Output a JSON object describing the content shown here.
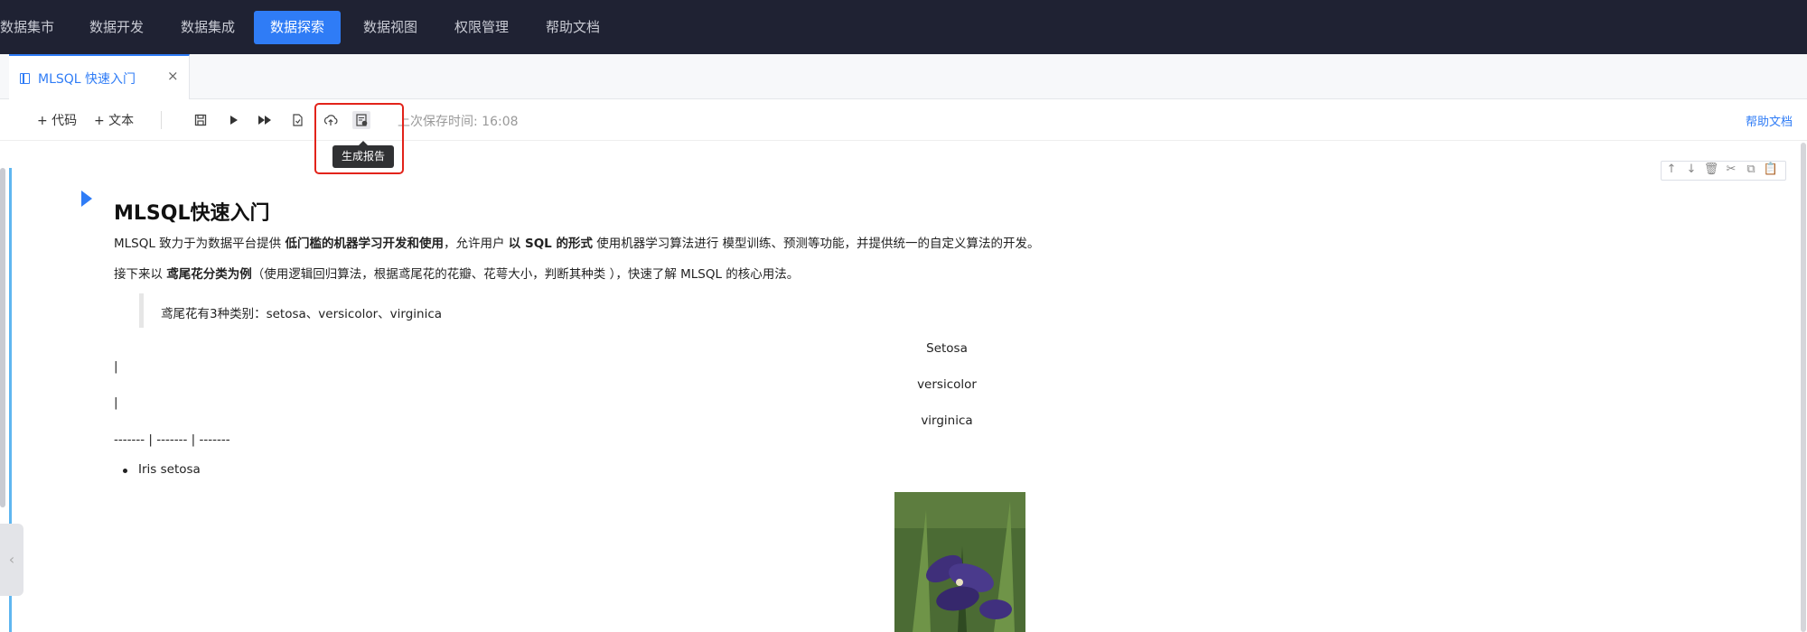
{
  "topnav": {
    "items": [
      {
        "label": "数据集市"
      },
      {
        "label": "数据开发"
      },
      {
        "label": "数据集成"
      },
      {
        "label": "数据探索",
        "active": true
      },
      {
        "label": "数据视图"
      },
      {
        "label": "权限管理"
      },
      {
        "label": "帮助文档"
      }
    ]
  },
  "tab": {
    "label": "MLSQL 快速入门",
    "close": "×"
  },
  "toolbar": {
    "add_code": "+ 代码",
    "add_text": "+ 文本",
    "save_time": "上次保存时间: 16:08",
    "tooltip": "生成报告",
    "help": "帮助文档"
  },
  "doc": {
    "title": "MLSQL快速入门",
    "p1": {
      "a": "MLSQL 致力于为数据平台提供 ",
      "b": "低门槛的机器学习开发和使用",
      "c": "，允许用户 ",
      "d": "以 SQL 的形式",
      "e": " 使用机器学习算法进行 模型训练、预测等功能，并提供统一的自定义算法的开发。"
    },
    "p2": {
      "a": "接下来以 ",
      "b": "鸢尾花分类为例",
      "c": "（使用逻辑回归算法，根据鸢尾花的花瓣、花萼大小，判断其种类 ），快速了解 MLSQL 的核心用法。"
    },
    "quote": "鸢尾花有3种类别：setosa、versicolor、virginica",
    "table_col1": "Setosa",
    "pipe1": "|",
    "table_col2": "versicolor",
    "pipe2": "|",
    "table_col3": "virginica",
    "separator": "------- | ------- | -------",
    "list_item": "Iris setosa"
  },
  "colors": {
    "nav_bg": "#1f2233",
    "accent": "#2f7cf6",
    "highlight_border": "#e2231a"
  }
}
